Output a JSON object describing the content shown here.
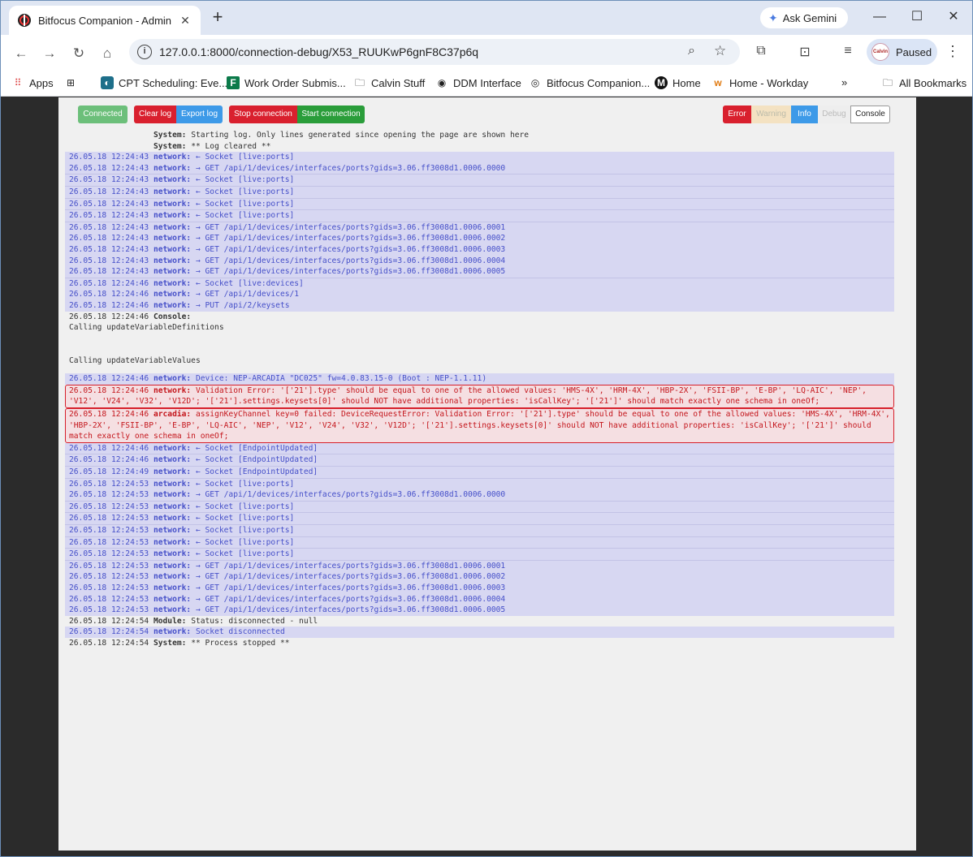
{
  "browser": {
    "tab_title": "Bitfocus Companion - Admin",
    "url": "127.0.0.1:8000/connection-debug/X53_RUUKwP6gnF8C37p6q",
    "gemini_label": "Ask Gemini",
    "profile_label": "Paused",
    "profile_avatar_text": "Calvin",
    "bookmarks": [
      "Apps",
      "CPT Scheduling: Eve...",
      "Work Order Submis...",
      "Calvin Stuff",
      "DDM Interface",
      "Bitfocus Companion...",
      "Home",
      "Home - Workday",
      "All Bookmarks"
    ]
  },
  "toolbar": {
    "connected": "Connected",
    "clear_log": "Clear log",
    "export_log": "Export log",
    "stop_connection": "Stop connection",
    "start_connection": "Start connection"
  },
  "filters": {
    "error": "Error",
    "warning": "Warning",
    "info": "Info",
    "debug": "Debug",
    "console": "Console"
  },
  "log": [
    {
      "kind": "sys",
      "ts": "",
      "src": "System:",
      "msg": "Starting log. Only lines generated since opening the page are shown here"
    },
    {
      "kind": "sys",
      "ts": "",
      "src": "System:",
      "msg": "** Log cleared **"
    },
    {
      "kind": "net",
      "ts": "26.05.18 12:24:43",
      "src": "network:",
      "msg": "← Socket [live:ports]"
    },
    {
      "kind": "net",
      "ts": "26.05.18 12:24:43",
      "src": "network:",
      "msg": "→ GET /api/1/devices/interfaces/ports?gids=3.06.ff3008d1.0006.0000"
    },
    {
      "kind": "net",
      "sep": true,
      "ts": "26.05.18 12:24:43",
      "src": "network:",
      "msg": "← Socket [live:ports]"
    },
    {
      "kind": "net",
      "sep": true,
      "ts": "26.05.18 12:24:43",
      "src": "network:",
      "msg": "← Socket [live:ports]"
    },
    {
      "kind": "net",
      "sep": true,
      "ts": "26.05.18 12:24:43",
      "src": "network:",
      "msg": "← Socket [live:ports]"
    },
    {
      "kind": "net",
      "sep": true,
      "ts": "26.05.18 12:24:43",
      "src": "network:",
      "msg": "← Socket [live:ports]"
    },
    {
      "kind": "net",
      "sep": true,
      "ts": "26.05.18 12:24:43",
      "src": "network:",
      "msg": "→ GET /api/1/devices/interfaces/ports?gids=3.06.ff3008d1.0006.0001"
    },
    {
      "kind": "net",
      "ts": "26.05.18 12:24:43",
      "src": "network:",
      "msg": "→ GET /api/1/devices/interfaces/ports?gids=3.06.ff3008d1.0006.0002"
    },
    {
      "kind": "net",
      "ts": "26.05.18 12:24:43",
      "src": "network:",
      "msg": "→ GET /api/1/devices/interfaces/ports?gids=3.06.ff3008d1.0006.0003"
    },
    {
      "kind": "net",
      "ts": "26.05.18 12:24:43",
      "src": "network:",
      "msg": "→ GET /api/1/devices/interfaces/ports?gids=3.06.ff3008d1.0006.0004"
    },
    {
      "kind": "net",
      "ts": "26.05.18 12:24:43",
      "src": "network:",
      "msg": "→ GET /api/1/devices/interfaces/ports?gids=3.06.ff3008d1.0006.0005"
    },
    {
      "kind": "net",
      "sep": true,
      "ts": "26.05.18 12:24:46",
      "src": "network:",
      "msg": "← Socket [live:devices]"
    },
    {
      "kind": "net",
      "ts": "26.05.18 12:24:46",
      "src": "network:",
      "msg": "→ GET /api/1/devices/1"
    },
    {
      "kind": "net",
      "ts": "26.05.18 12:24:46",
      "src": "network:",
      "msg": "→ PUT /api/2/keysets"
    },
    {
      "kind": "con",
      "ts": "26.05.18 12:24:46",
      "src": "Console:",
      "msg": ""
    },
    {
      "kind": "con",
      "ts": "",
      "src": "",
      "msg": "Calling updateVariableDefinitions"
    },
    {
      "kind": "spacer"
    },
    {
      "kind": "con",
      "ts": "",
      "src": "",
      "msg": "Calling updateVariableValues"
    },
    {
      "kind": "spacer2"
    },
    {
      "kind": "net",
      "ts": "26.05.18 12:24:46",
      "src": "network:",
      "msg": "Device: NEP-ARCADIA \"DC025\" fw=4.0.83.15-0 (Boot : NEP-1.1.11)"
    },
    {
      "kind": "err",
      "ts": "26.05.18 12:24:46",
      "src": "network:",
      "msg": "Validation Error: '['21'].type' should be equal to one of the allowed values: 'HMS-4X', 'HRM-4X', 'HBP-2X', 'FSII-BP', 'E-BP', 'LQ-AIC', 'NEP', 'V12', 'V24', 'V32', 'V12D'; '['21'].settings.keysets[0]' should NOT have additional properties: 'isCallKey'; '['21']' should match exactly one schema in oneOf;"
    },
    {
      "kind": "err",
      "ts": "26.05.18 12:24:46",
      "src": "arcadia:",
      "msg": "assignKeyChannel key=0 failed: DeviceRequestError: Validation Error: '['21'].type' should be equal to one of the allowed values: 'HMS-4X', 'HRM-4X', 'HBP-2X', 'FSII-BP', 'E-BP', 'LQ-AIC', 'NEP', 'V12', 'V24', 'V32', 'V12D'; '['21'].settings.keysets[0]' should NOT have additional properties: 'isCallKey'; '['21']' should match exactly one schema in oneOf;"
    },
    {
      "kind": "net",
      "ts": "26.05.18 12:24:46",
      "src": "network:",
      "msg": "← Socket [EndpointUpdated]"
    },
    {
      "kind": "net",
      "sep": true,
      "ts": "26.05.18 12:24:46",
      "src": "network:",
      "msg": "← Socket [EndpointUpdated]"
    },
    {
      "kind": "net",
      "sep": true,
      "ts": "26.05.18 12:24:49",
      "src": "network:",
      "msg": "← Socket [EndpointUpdated]"
    },
    {
      "kind": "net",
      "sep": true,
      "ts": "26.05.18 12:24:53",
      "src": "network:",
      "msg": "← Socket [live:ports]"
    },
    {
      "kind": "net",
      "ts": "26.05.18 12:24:53",
      "src": "network:",
      "msg": "→ GET /api/1/devices/interfaces/ports?gids=3.06.ff3008d1.0006.0000"
    },
    {
      "kind": "net",
      "sep": true,
      "ts": "26.05.18 12:24:53",
      "src": "network:",
      "msg": "← Socket [live:ports]"
    },
    {
      "kind": "net",
      "sep": true,
      "ts": "26.05.18 12:24:53",
      "src": "network:",
      "msg": "← Socket [live:ports]"
    },
    {
      "kind": "net",
      "sep": true,
      "ts": "26.05.18 12:24:53",
      "src": "network:",
      "msg": "← Socket [live:ports]"
    },
    {
      "kind": "net",
      "sep": true,
      "ts": "26.05.18 12:24:53",
      "src": "network:",
      "msg": "← Socket [live:ports]"
    },
    {
      "kind": "net",
      "sep": true,
      "ts": "26.05.18 12:24:53",
      "src": "network:",
      "msg": "← Socket [live:ports]"
    },
    {
      "kind": "net",
      "sep": true,
      "ts": "26.05.18 12:24:53",
      "src": "network:",
      "msg": "→ GET /api/1/devices/interfaces/ports?gids=3.06.ff3008d1.0006.0001"
    },
    {
      "kind": "net",
      "ts": "26.05.18 12:24:53",
      "src": "network:",
      "msg": "→ GET /api/1/devices/interfaces/ports?gids=3.06.ff3008d1.0006.0002"
    },
    {
      "kind": "net",
      "ts": "26.05.18 12:24:53",
      "src": "network:",
      "msg": "→ GET /api/1/devices/interfaces/ports?gids=3.06.ff3008d1.0006.0003"
    },
    {
      "kind": "net",
      "ts": "26.05.18 12:24:53",
      "src": "network:",
      "msg": "→ GET /api/1/devices/interfaces/ports?gids=3.06.ff3008d1.0006.0004"
    },
    {
      "kind": "net",
      "ts": "26.05.18 12:24:53",
      "src": "network:",
      "msg": "→ GET /api/1/devices/interfaces/ports?gids=3.06.ff3008d1.0006.0005"
    },
    {
      "kind": "sys",
      "ts": "26.05.18 12:24:54",
      "src": "Module:",
      "msg": "Status: disconnected - null"
    },
    {
      "kind": "net",
      "ts": "26.05.18 12:24:54",
      "src": "network:",
      "msg": "Socket disconnected"
    },
    {
      "kind": "sys",
      "ts": "26.05.18 12:24:54",
      "src": "System:",
      "msg": "** Process stopped **"
    }
  ]
}
